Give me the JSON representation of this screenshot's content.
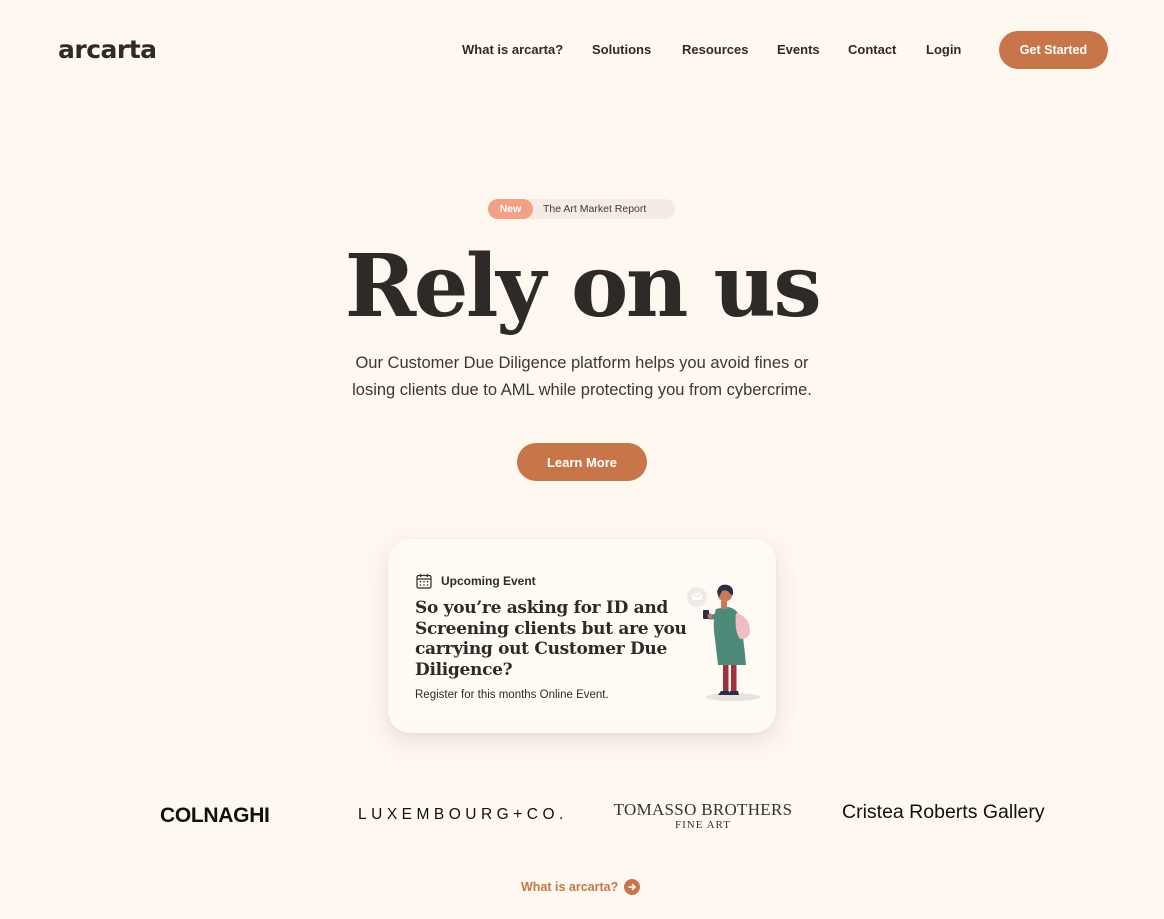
{
  "header": {
    "logo": "arcarta",
    "nav": [
      {
        "label": "What is arcarta?"
      },
      {
        "label": "Solutions"
      },
      {
        "label": "Resources"
      },
      {
        "label": "Events"
      },
      {
        "label": "Contact"
      },
      {
        "label": "Login"
      }
    ],
    "cta_label": "Get Started"
  },
  "hero": {
    "badge_new": "New",
    "badge_text": "The Art Market Report",
    "title": "Rely on us",
    "subtitle": "Our Customer Due Diligence platform helps you avoid fines or losing clients due to AML while protecting you from cybercrime.",
    "cta_label": "Learn More"
  },
  "event_card": {
    "icon": "calendar-icon",
    "label": "Upcoming Event",
    "title": "So you’re asking for ID and Screening clients but are you carrying out Customer Due Diligence?",
    "description": "Register for this months Online Event."
  },
  "client_logos": {
    "colnaghi": "COLNAGHI",
    "luxembourg": "LUXEMBOURG+CO.",
    "tomasso_main": "TOMASSO BROTHERS",
    "tomasso_sub": "FINE ART",
    "cristea": "Cristea Roberts Gallery"
  },
  "footer_link": {
    "label": "What is arcarta?",
    "icon": "arrow-right-circle-icon"
  },
  "colors": {
    "background": "#fef8f1",
    "accent": "#c8754a",
    "badge": "#f2a086",
    "text": "#2e2a27"
  }
}
